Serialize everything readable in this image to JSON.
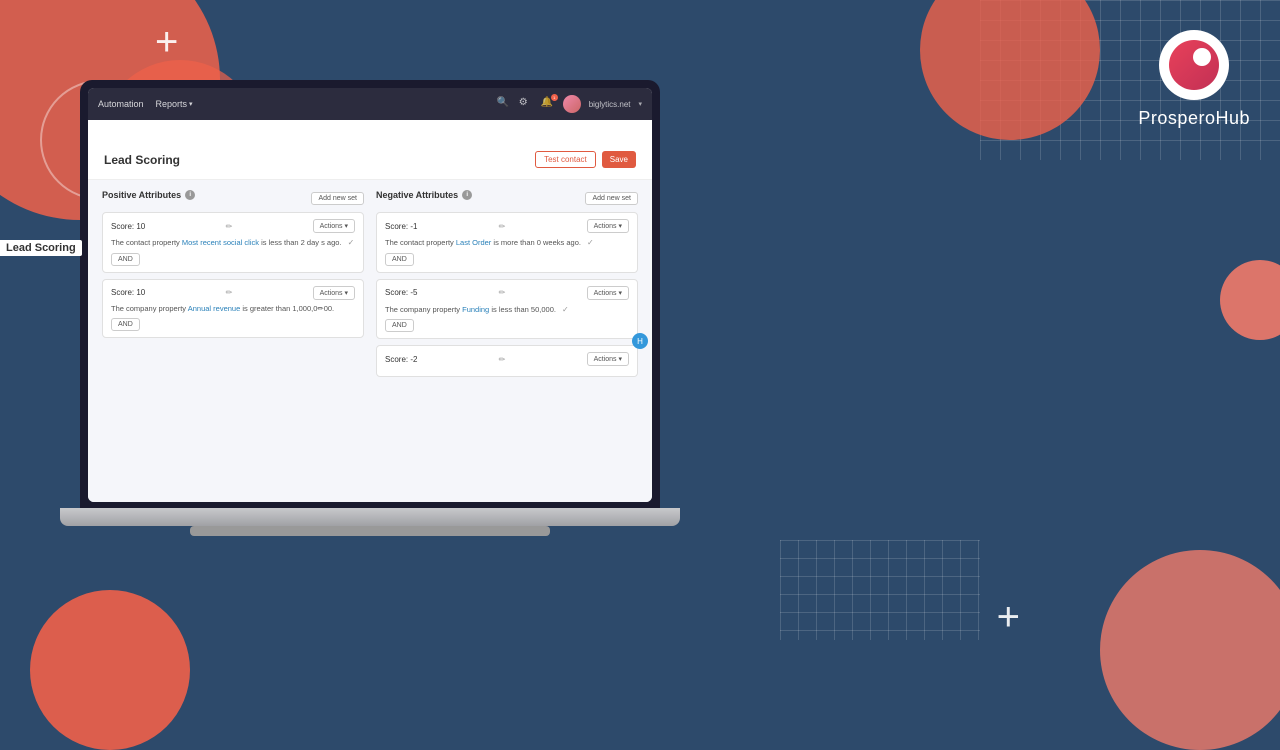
{
  "background": {
    "color": "#2d4a6b"
  },
  "logo": {
    "name": "ProsperoHub",
    "name_bold": "Prospero",
    "name_light": "Hub"
  },
  "navbar": {
    "items": [
      {
        "label": "Automation"
      },
      {
        "label": "Reports"
      }
    ],
    "domain": "biglytics.net",
    "notification_count": "1"
  },
  "page": {
    "title": "Lead Scoring",
    "btn_test": "Test contact",
    "btn_save": "Save"
  },
  "positive_attributes": {
    "heading": "Positive Attributes",
    "add_new_set": "Add new set",
    "cards": [
      {
        "score": "Score: 10",
        "condition": "The contact property Most recent social click is less than 2 day s ago.",
        "link_text": "Most recent social click",
        "has_and": true
      },
      {
        "score": "Score: 10",
        "condition": "The company property Annual revenue is greater than 1,000,000.",
        "link_text": "Annual revenue",
        "has_and": true
      }
    ]
  },
  "negative_attributes": {
    "heading": "Negative Attributes",
    "add_new_set": "Add new set",
    "cards": [
      {
        "score": "Score: -1",
        "condition": "The contact property Last Order is more than 0 weeks ago.",
        "link_text": "Last Order",
        "has_and": true
      },
      {
        "score": "Score: -5",
        "condition": "The company property Funding is less than 50,000.",
        "link_text": "Funding",
        "has_and": true
      },
      {
        "score": "Score: -2",
        "condition": "",
        "has_and": false
      }
    ]
  }
}
